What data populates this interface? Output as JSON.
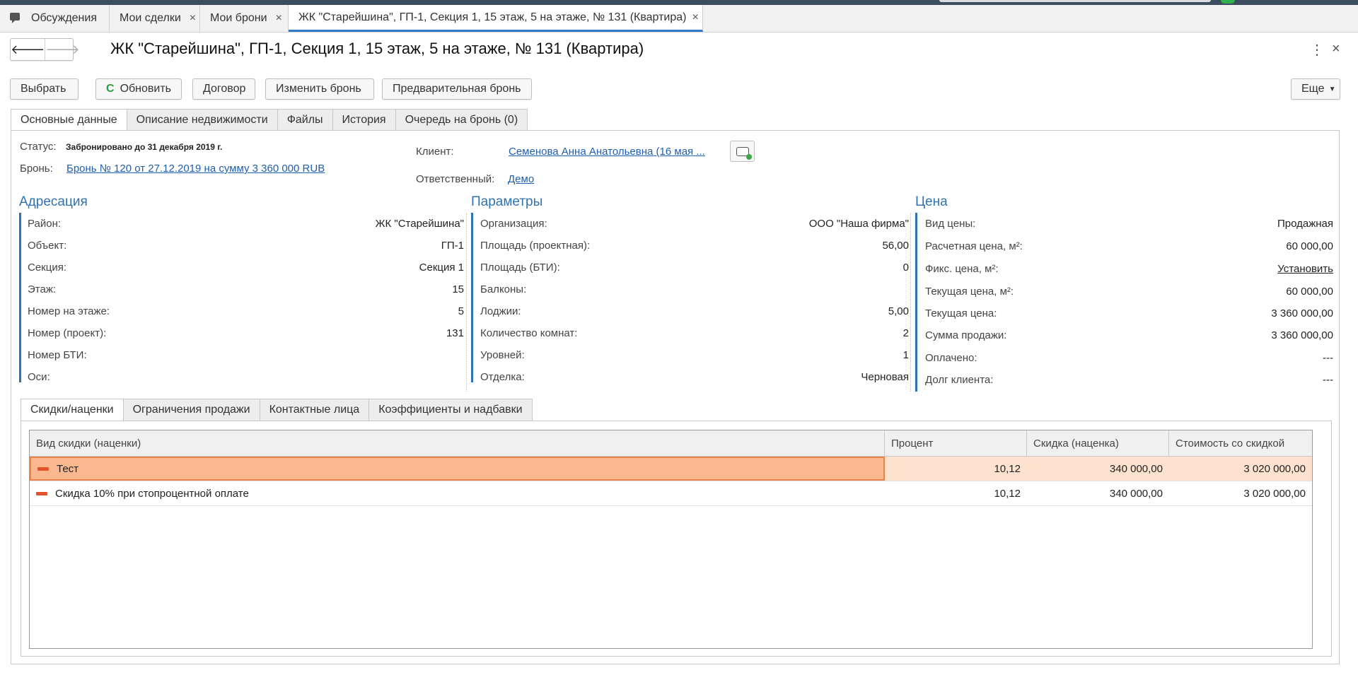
{
  "open_tabs": [
    {
      "label": "Обсуждения",
      "icon": "discussion-icon"
    },
    {
      "label": "Мои сделки",
      "close": "×"
    },
    {
      "label": "Мои брони",
      "close": "×"
    },
    {
      "label": "ЖК \"Старейшина\", ГП-1, Секция 1, 15 этаж, 5 на этаже, № 131 (Квартира)",
      "close": "×"
    }
  ],
  "nav": {
    "back": "🡐",
    "forward": "🡒"
  },
  "window": {
    "title": "ЖК \"Старейшина\", ГП-1, Секция 1, 15 этаж, 5 на этаже, № 131 (Квартира)",
    "more_icon": "⋮",
    "close_icon": "×"
  },
  "toolbar": {
    "select": "Выбрать",
    "refresh_icon": "C",
    "refresh": "Обновить",
    "contract": "Договор",
    "change_booking": "Изменить бронь",
    "pre_booking": "Предварительная бронь",
    "more": "Еще",
    "more_caret": "▼"
  },
  "form_tabs": [
    "Основные данные",
    "Описание недвижимости",
    "Файлы",
    "История",
    "Очередь на бронь (0)"
  ],
  "main": {
    "status_label": "Статус:",
    "status_value": "Забронировано до 31 декабря 2019 г.",
    "booking_label": "Бронь:",
    "booking_value": "Бронь № 120 от 27.12.2019 на сумму 3 360 000 RUB",
    "client_label": "Клиент:",
    "client_value": "Семенова Анна Анатольевна (16 мая ...",
    "responsible_label": "Ответственный:",
    "responsible_value": "Демо"
  },
  "addressing": {
    "title": "Адресация",
    "rows": [
      {
        "label": "Район:",
        "value": "ЖК \"Старейшина\""
      },
      {
        "label": "Объект:",
        "value": "ГП-1"
      },
      {
        "label": "Секция:",
        "value": "Секция 1"
      },
      {
        "label": "Этаж:",
        "value": "15"
      },
      {
        "label": "Номер на этаже:",
        "value": "5"
      },
      {
        "label": "Номер (проект):",
        "value": "131"
      },
      {
        "label": "Номер БТИ:",
        "value": ""
      },
      {
        "label": "Оси:",
        "value": ""
      }
    ]
  },
  "parameters": {
    "title": "Параметры",
    "rows": [
      {
        "label": "Организация:",
        "value": "ООО \"Наша фирма\""
      },
      {
        "label": "Площадь (проектная):",
        "value": "56,00"
      },
      {
        "label": "Площадь (БТИ):",
        "value": "0"
      },
      {
        "label": "Балконы:",
        "value": ""
      },
      {
        "label": "Лоджии:",
        "value": "5,00"
      },
      {
        "label": "Количество комнат:",
        "value": "2"
      },
      {
        "label": "Уровней:",
        "value": "1"
      },
      {
        "label": "Отделка:",
        "value": "Черновая"
      }
    ]
  },
  "price": {
    "title": "Цена",
    "rows": [
      {
        "label": "Вид цены:",
        "value": "Продажная"
      },
      {
        "label": "Расчетная цена, м²:",
        "value": "60 000,00"
      },
      {
        "label": "Фикс. цена, м²:",
        "value": "Установить",
        "link": true
      },
      {
        "label": "Текущая цена, м²:",
        "value": "60 000,00"
      },
      {
        "label": "Текущая цена:",
        "value": "3 360 000,00"
      },
      {
        "label": "Сумма продажи:",
        "value": "3 360 000,00"
      },
      {
        "label": "Оплачено:",
        "value": "---"
      },
      {
        "label": "Долг клиента:",
        "value": "---"
      }
    ]
  },
  "bottom_tabs": [
    "Скидки/наценки",
    "Ограничения продажи",
    "Контактные лица",
    "Коэффициенты и надбавки"
  ],
  "discounts_table": {
    "columns": [
      "Вид скидки (наценки)",
      "Процент",
      "Скидка (наценка)",
      "Стоимость со скидкой"
    ],
    "rows": [
      {
        "name": "Тест",
        "percent": "10,12",
        "discount": "340 000,00",
        "cost": "3 020 000,00",
        "selected": true
      },
      {
        "name": "Скидка 10% при стопроцентной оплате",
        "percent": "10,12",
        "discount": "340 000,00",
        "cost": "3 020 000,00",
        "selected": false
      }
    ]
  },
  "colors": {
    "accent": "#2f73b3",
    "link": "#1f5fb0",
    "selected_row": "#fde2d0",
    "minus_icon": "#e0532c"
  }
}
